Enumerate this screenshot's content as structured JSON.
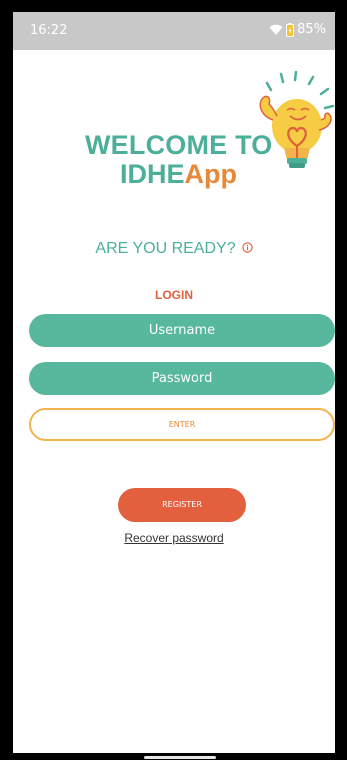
{
  "status_bar": {
    "time": "16:22",
    "battery": "85%",
    "icons": [
      "wifi-icon",
      "battery-icon"
    ]
  },
  "welcome": {
    "line1": "WELCOME TO",
    "brand_part1": "IDHE",
    "brand_part2": "App"
  },
  "ready": {
    "text": "ARE YOU READY?",
    "icon": "info-icon"
  },
  "login": {
    "title": "LOGIN",
    "username_placeholder": "Username",
    "password_placeholder": "Password",
    "enter_label": "ENTER"
  },
  "register": {
    "label": "REGISTER"
  },
  "recover": {
    "label": "Recover password"
  },
  "colors": {
    "teal": "#57b89e",
    "orange": "#e8893a",
    "red": "#e2603d",
    "yellow": "#f2b44a"
  }
}
